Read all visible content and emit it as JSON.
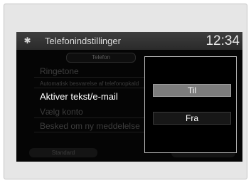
{
  "header": {
    "settings_icon": "gear-icon",
    "title": "Telefonindstillinger",
    "clock": "12:34"
  },
  "tab": {
    "label": "Telefon"
  },
  "menu": {
    "items": [
      {
        "label": "Ringetone"
      },
      {
        "label": "Automatisk besvarelse af telefonopkald"
      },
      {
        "label": "Aktiver tekst/e-mail"
      },
      {
        "label": "Vælg konto"
      },
      {
        "label": "Besked om ny meddelelse"
      }
    ]
  },
  "footer": {
    "default_label": "Standard"
  },
  "popup": {
    "options": [
      {
        "label": "Til"
      },
      {
        "label": "Fra"
      }
    ]
  }
}
